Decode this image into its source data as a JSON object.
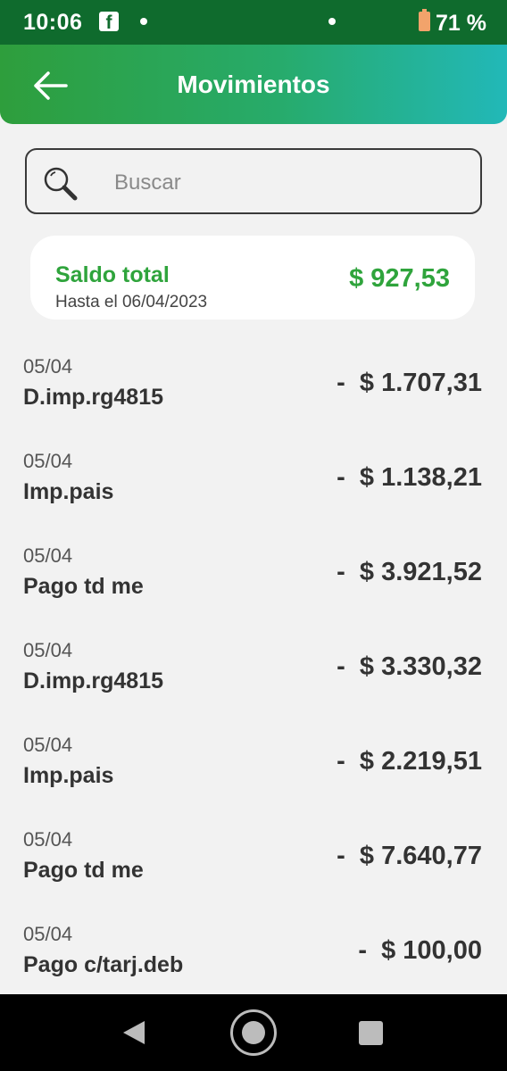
{
  "status_bar": {
    "time": "10:06",
    "app_icon": "facebook-icon",
    "battery_percent": "71 %"
  },
  "header": {
    "title": "Movimientos",
    "back_icon": "arrow-left-icon"
  },
  "search": {
    "placeholder": "Buscar",
    "value": ""
  },
  "balance": {
    "label": "Saldo total",
    "date_text": "Hasta el 06/04/2023",
    "amount": "$ 927,53"
  },
  "movements": [
    {
      "date": "05/04",
      "description": "D.imp.rg4815",
      "amount": "-  $ 1.707,31"
    },
    {
      "date": "05/04",
      "description": "Imp.pais",
      "amount": "-  $ 1.138,21"
    },
    {
      "date": "05/04",
      "description": "Pago td me",
      "amount": "-  $ 3.921,52"
    },
    {
      "date": "05/04",
      "description": "D.imp.rg4815",
      "amount": "-  $ 3.330,32"
    },
    {
      "date": "05/04",
      "description": "Imp.pais",
      "amount": "-  $ 2.219,51"
    },
    {
      "date": "05/04",
      "description": "Pago td me",
      "amount": "-  $ 7.640,77"
    },
    {
      "date": "05/04",
      "description": "Pago c/tarj.deb",
      "amount": "-  $ 100,00"
    }
  ],
  "colors": {
    "status_bar": "#0f6b2d",
    "header_start": "#2e9e3c",
    "header_end": "#22b8b8",
    "accent_green": "#2fa43c",
    "background": "#f2f2f2"
  }
}
